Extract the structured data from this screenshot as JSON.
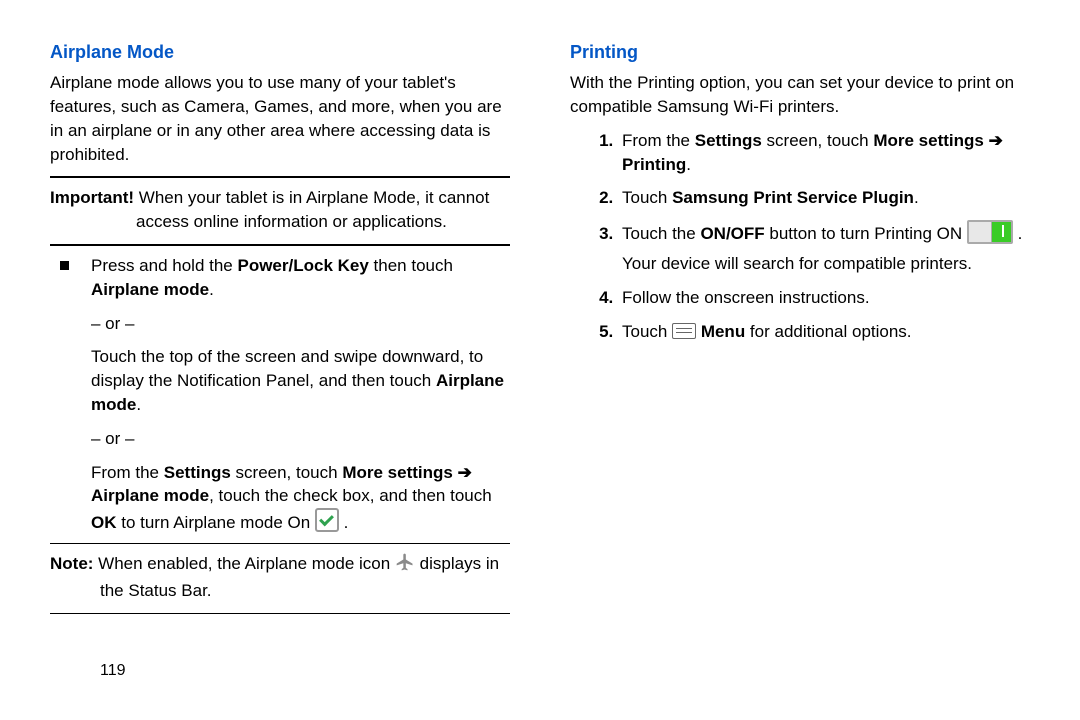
{
  "left": {
    "heading": "Airplane Mode",
    "intro": "Airplane mode allows you to use many of your tablet's features, such as Camera, Games, and more, when you are in an airplane or in any other area where accessing data is prohibited.",
    "important_label": "Important! ",
    "important_text_line1": "When your tablet is in Airplane Mode, it cannot",
    "important_text_line2": "access online information or applications.",
    "bullet": {
      "line1a": "Press and hold the ",
      "line1b": "Power/Lock Key",
      "line1c": " then touch ",
      "line1d": "Airplane mode",
      "line1e": ".",
      "or": "– or –",
      "line2a": "Touch the top of the screen and swipe downward, to display the Notification Panel, and then touch ",
      "line2b": "Airplane mode",
      "line2c": ".",
      "line3a": "From the ",
      "line3b": "Settings",
      "line3c": " screen, touch ",
      "line3d": "More settings",
      "line3arrow": " ➔ ",
      "line3e": "Airplane mode",
      "line3f": ", touch the check box, and then touch ",
      "line3g": "OK",
      "line3h": " to turn Airplane mode On ",
      "line3i": " ."
    },
    "note_label": "Note: ",
    "note_text_a": "When enabled, the Airplane mode icon ",
    "note_text_b": " displays in",
    "note_text_c": "the Status Bar."
  },
  "right": {
    "heading": "Printing",
    "intro": "With the Printing option, you can set your device to print on compatible Samsung Wi-Fi printers.",
    "steps": {
      "s1a": "From the ",
      "s1b": "Settings",
      "s1c": " screen, touch ",
      "s1d": "More settings",
      "s1arrow": " ➔ ",
      "s1e": "Printing",
      "s1f": ".",
      "s2a": "Touch ",
      "s2b": "Samsung Print Service Plugin",
      "s2c": ".",
      "s3a": "Touch the ",
      "s3b": "ON/OFF",
      "s3c": " button to turn Printing ON ",
      "s3d": " .",
      "s3e": "Your device will search for compatible printers.",
      "s4": "Follow the onscreen instructions.",
      "s5a": "Touch ",
      "s5b": " Menu",
      "s5c": " for additional options."
    }
  },
  "page_number": "119"
}
